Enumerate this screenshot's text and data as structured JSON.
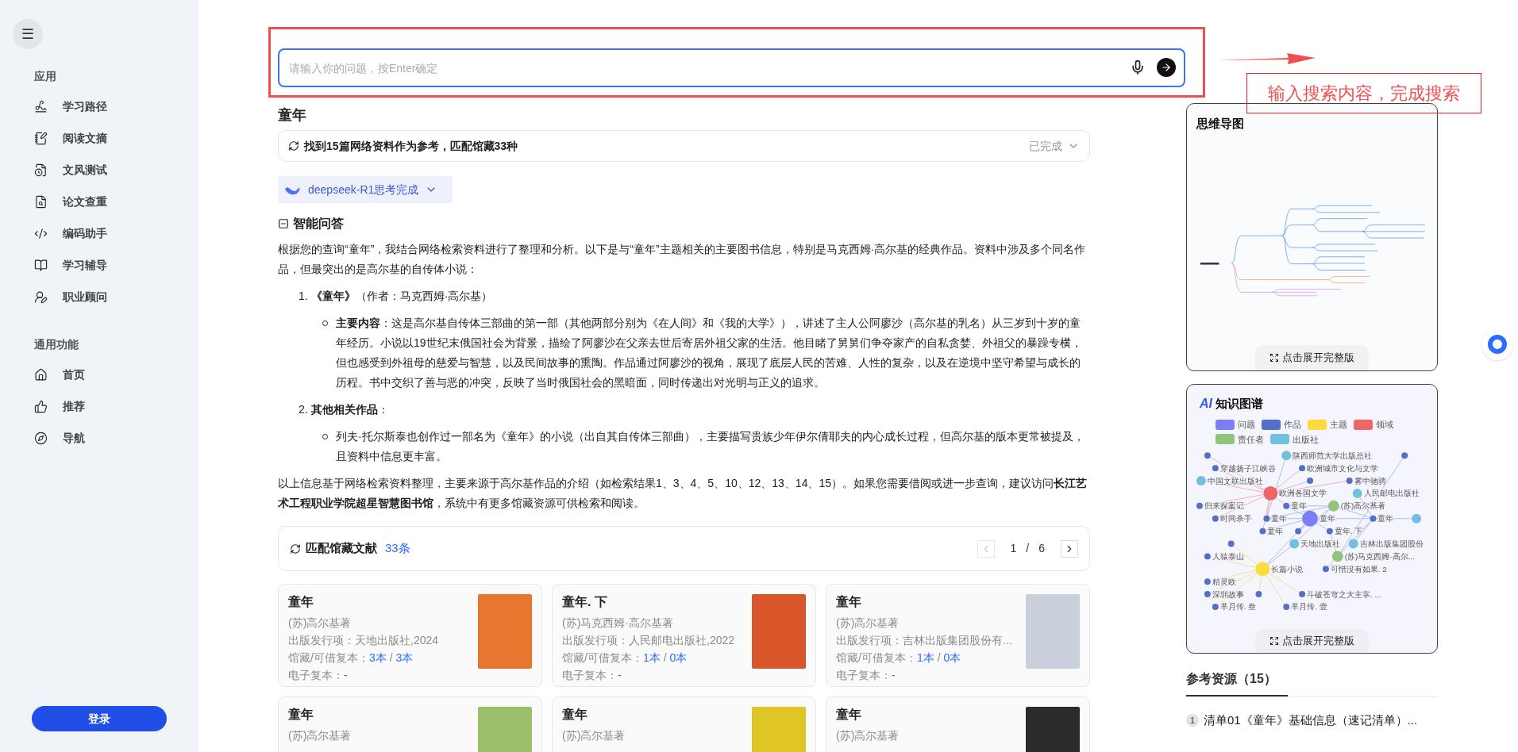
{
  "sidebar": {
    "menu_button": "☰",
    "sections": [
      {
        "title": "应用",
        "items": [
          {
            "label": "学习路径"
          },
          {
            "label": "阅读文摘"
          },
          {
            "label": "文风测试"
          },
          {
            "label": "论文查重"
          },
          {
            "label": "编码助手"
          },
          {
            "label": "学习辅导"
          },
          {
            "label": "职业顾问"
          }
        ]
      },
      {
        "title": "通用功能",
        "items": [
          {
            "label": "首页"
          },
          {
            "label": "推荐"
          },
          {
            "label": "导航"
          }
        ]
      }
    ],
    "login_button": "登录"
  },
  "search": {
    "placeholder": "请输入你的问题，按Enter确定"
  },
  "annotation": {
    "label": "输入搜索内容，完成搜索"
  },
  "query_title": "童年",
  "search_status": {
    "text": "找到15篇网络资料作为参考，匹配馆藏33种",
    "status": "已完成"
  },
  "model_pill": {
    "label": "deepseek-R1思考完成"
  },
  "answer": {
    "title": "智能问答",
    "intro": "根据您的查询“童年”，我结合网络检索资料进行了整理和分析。以下是与“童年”主题相关的主要图书信息，特别是马克西姆·高尔基的经典作品。资料中涉及多个同名作品，但最突出的是高尔基的自传体小说：",
    "items": [
      {
        "number": "1.",
        "text": "**《童年》**（作者：马克西姆·高尔基）",
        "bullets": [
          "**主要内容**：这是高尔基自传体三部曲的第一部（其他两部分别为《在人间》和《我的大学》），讲述了主人公阿廖沙（高尔基的乳名）从三岁到十岁的童年经历。小说以19世纪末俄国社会为背景，描绘了阿廖沙在父亲去世后寄居外祖父家的生活。他目睹了舅舅们争夺家产的自私贪婪、外祖父的暴躁专横，但也感受到外祖母的慈爱与智慧，以及民间故事的熏陶。作品通过阿廖沙的视角，展现了底层人民的苦难、人性的复杂，以及在逆境中坚守希望与成长的历程。书中交织了善与恶的冲突，反映了当时俄国社会的黑暗面，同时传递出对光明与正义的追求。"
        ]
      },
      {
        "number": "2.",
        "text": "**其他相关作品**：",
        "bullets": [
          "列夫·托尔斯泰也创作过一部名为《童年》的小说（出自其自传体三部曲），主要描写贵族少年伊尔倩耶夫的内心成长过程，但高尔基的版本更常被提及，且资料中信息更丰富。"
        ]
      }
    ],
    "conclusion": "以上信息基于网络检索资料整理，主要来源于高尔基作品的介绍（如检索结果1、3、4、5、10、12、13、14、15）。如果您需要借阅或进一步查询，建议访问**长江艺术工程职业学院超星智慧图书馆**，系统中有更多馆藏资源可供检索和阅读。"
  },
  "collection": {
    "title": "匹配馆藏文献",
    "count": "33条",
    "page": "1",
    "separator": "/",
    "pages": "6",
    "prev_disabled": true,
    "books": [
      {
        "title": "童年",
        "author": "(苏)高尔基著",
        "publisher_label": "出版发行项：",
        "publisher": "天地出版社,2024",
        "copies_label": "馆藏/可借复本：",
        "held": "3本",
        "separator": "/",
        "available": "3本",
        "ebook_label": "电子复本：",
        "ebook": "-"
      },
      {
        "title": "童年. 下",
        "author": "(苏)马克西姆·高尔基著",
        "publisher_label": "出版发行项：",
        "publisher": "人民邮电出版社,2022",
        "copies_label": "馆藏/可借复本：",
        "held": "1本",
        "separator": "/",
        "available": "0本",
        "ebook_label": "电子复本：",
        "ebook": "-"
      },
      {
        "title": "童年",
        "author": "(苏)高尔基著",
        "publisher_label": "出版发行项：",
        "publisher": "吉林出版集团股份有...",
        "copies_label": "馆藏/可借复本：",
        "held": "1本",
        "separator": "/",
        "available": "0本",
        "ebook_label": "电子复本：",
        "ebook": "-"
      },
      {
        "title": "童年",
        "author": "(苏)高尔基著"
      },
      {
        "title": "童年",
        "author": "(苏)高尔基著"
      },
      {
        "title": "童年",
        "author": "(苏)高尔基著"
      }
    ]
  },
  "mind_map": {
    "title": "思维导图",
    "expand_button": "点击展开完整版"
  },
  "knowledge_graph": {
    "ai_mark": "AI",
    "title": "知识图谱",
    "expand_button": "点击展开完整版",
    "legend": [
      {
        "kind": "question",
        "label": "问题",
        "color": "#7b7ff5"
      },
      {
        "kind": "work",
        "label": "作品",
        "color": "#5470c6"
      },
      {
        "kind": "topic",
        "label": "主题",
        "color": "#fddb3a"
      },
      {
        "kind": "field",
        "label": "领域",
        "color": "#ee6666"
      },
      {
        "kind": "person",
        "label": "责任者",
        "color": "#91c47b"
      },
      {
        "kind": "publisher",
        "label": "出版社",
        "color": "#73c0de"
      }
    ],
    "nodes": [
      {
        "kind": "work"
      },
      {
        "kind": "publisher",
        "label": "陕西师范大学出版总社"
      },
      {
        "kind": "work"
      },
      {
        "kind": "work",
        "label": "穿越扬子江峡谷"
      },
      {
        "kind": "work",
        "label": "欧洲城市文化与文学"
      },
      {
        "kind": "publisher",
        "label": "中国文联出版社"
      },
      {
        "kind": "work"
      },
      {
        "kind": "work",
        "label": "雾中驰骋"
      },
      {
        "kind": "field",
        "label": "欧洲各国文学"
      },
      {
        "kind": "publisher",
        "label": "人民邮电出版社"
      },
      {
        "kind": "work",
        "label": "归来探案记"
      },
      {
        "kind": "work",
        "label": "童年"
      },
      {
        "kind": "person",
        "label": "(苏)高尔基著"
      },
      {
        "kind": "work",
        "label": "时间杀手"
      },
      {
        "kind": "work",
        "label": "童年"
      },
      {
        "kind": "question",
        "label": "童年"
      },
      {
        "kind": "work",
        "label": "童年"
      },
      {
        "kind": "publisher"
      },
      {
        "kind": "work",
        "label": "童年"
      },
      {
        "kind": "work"
      },
      {
        "kind": "work",
        "label": "童年. 下"
      },
      {
        "kind": "work"
      },
      {
        "kind": "publisher",
        "label": "天地出版社"
      },
      {
        "kind": "publisher",
        "label": "吉林出版集团股份"
      },
      {
        "kind": "work",
        "label": "人猿泰山"
      },
      {
        "kind": "person",
        "label": "(苏)马克西姆·高尔..."
      },
      {
        "kind": "topic",
        "label": "长篇小说"
      },
      {
        "kind": "work",
        "label": "可惜没有如果. 2"
      },
      {
        "kind": "work",
        "label": "精灵欧"
      },
      {
        "kind": "work",
        "label": "深圳故事"
      },
      {
        "kind": "work"
      },
      {
        "kind": "work",
        "label": "斗破苍穹之大主宰. ..."
      },
      {
        "kind": "work",
        "label": "芈月传. 叁"
      },
      {
        "kind": "work",
        "label": "芈月传. 壹"
      }
    ]
  },
  "references": {
    "tab": "参考资源（15）",
    "items": [
      {
        "number": "1",
        "title": "清单01《童年》基础信息（速记清单）..."
      }
    ]
  }
}
